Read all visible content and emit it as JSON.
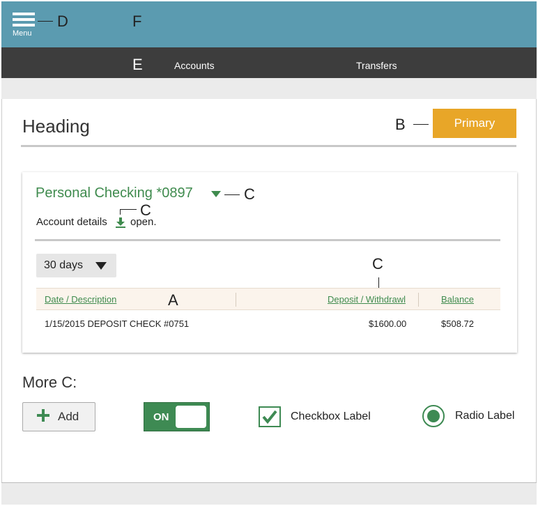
{
  "header": {
    "menu_label": "Menu"
  },
  "nav": {
    "items": [
      {
        "label": "Accounts"
      },
      {
        "label": "Transfers"
      }
    ]
  },
  "annotations": {
    "menu": "D",
    "header": "F",
    "nav": "E",
    "primary": "B",
    "account": "C",
    "details_icon": "C",
    "table_header": "A",
    "deposit_col": "C"
  },
  "page": {
    "heading": "Heading",
    "primary_label": "Primary"
  },
  "account": {
    "title": "Personal Checking *0897",
    "details_text": "Account details",
    "open_text": "open.",
    "period": "30 days",
    "columns": [
      "Date / Description",
      "Deposit / Withdrawl",
      "Balance"
    ],
    "rows": [
      {
        "description": "1/15/2015 DEPOSIT CHECK #0751",
        "amount": "$1600.00",
        "balance": "$508.72"
      }
    ]
  },
  "more": {
    "heading": "More C:",
    "add_label": "Add",
    "toggle_label": "ON",
    "checkbox_label": "Checkbox Label",
    "radio_label": "Radio Label"
  },
  "colors": {
    "header_bg": "#5b9bb0",
    "nav_bg": "#3d3d3d",
    "accent_green": "#3f8b4e",
    "primary_orange": "#e8a628"
  }
}
